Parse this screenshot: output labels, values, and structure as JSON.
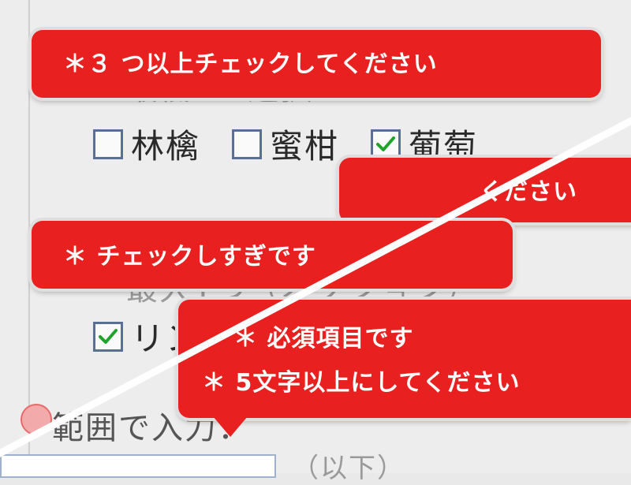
{
  "form": {
    "section1": {
      "label": "最低3つ選択：",
      "options": [
        {
          "label": "林檎",
          "checked": false
        },
        {
          "label": "蜜柑",
          "checked": false
        },
        {
          "label": "葡萄",
          "checked": true
        }
      ]
    },
    "section2": {
      "label": "最大1つ（オプション）",
      "options": [
        {
          "label": "リンゴ",
          "checked": true
        }
      ]
    },
    "section3": {
      "label": "範囲で入力：",
      "suffix": "（以下）"
    }
  },
  "tooltips": {
    "min_check": "＊３ つ以上チェックしてください",
    "hidden_right": "ください",
    "too_many": "＊ チェックしすぎです",
    "required": "＊ 必須項目です",
    "min_chars": "＊ 5文字以上にしてください"
  },
  "colors": {
    "tooltip_bg": "#e8201f",
    "check_mark": "#1fa32a",
    "checkbox_border": "#5a6f95"
  }
}
